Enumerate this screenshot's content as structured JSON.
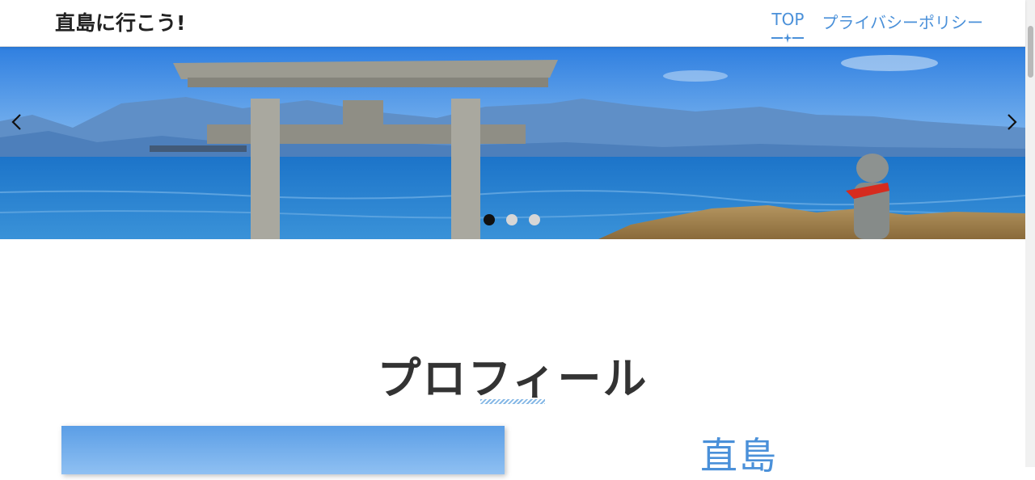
{
  "header": {
    "site_title": "直島に行こう!",
    "nav": [
      {
        "label": "TOP",
        "active": true
      },
      {
        "label": "プライバシーポリシー",
        "active": false
      }
    ]
  },
  "hero": {
    "slide_count": 3,
    "active_slide": 1,
    "image_subject": "torii-gate-by-the-sea",
    "prev_icon": "chevron-left-icon",
    "next_icon": "chevron-right-icon"
  },
  "profile": {
    "section_title": "プロフィール",
    "name": "直島"
  },
  "colors": {
    "accent": "#4a90d9",
    "title_text": "#222222",
    "dot_active": "#111111",
    "dot_inactive": "#d6d6d6"
  }
}
